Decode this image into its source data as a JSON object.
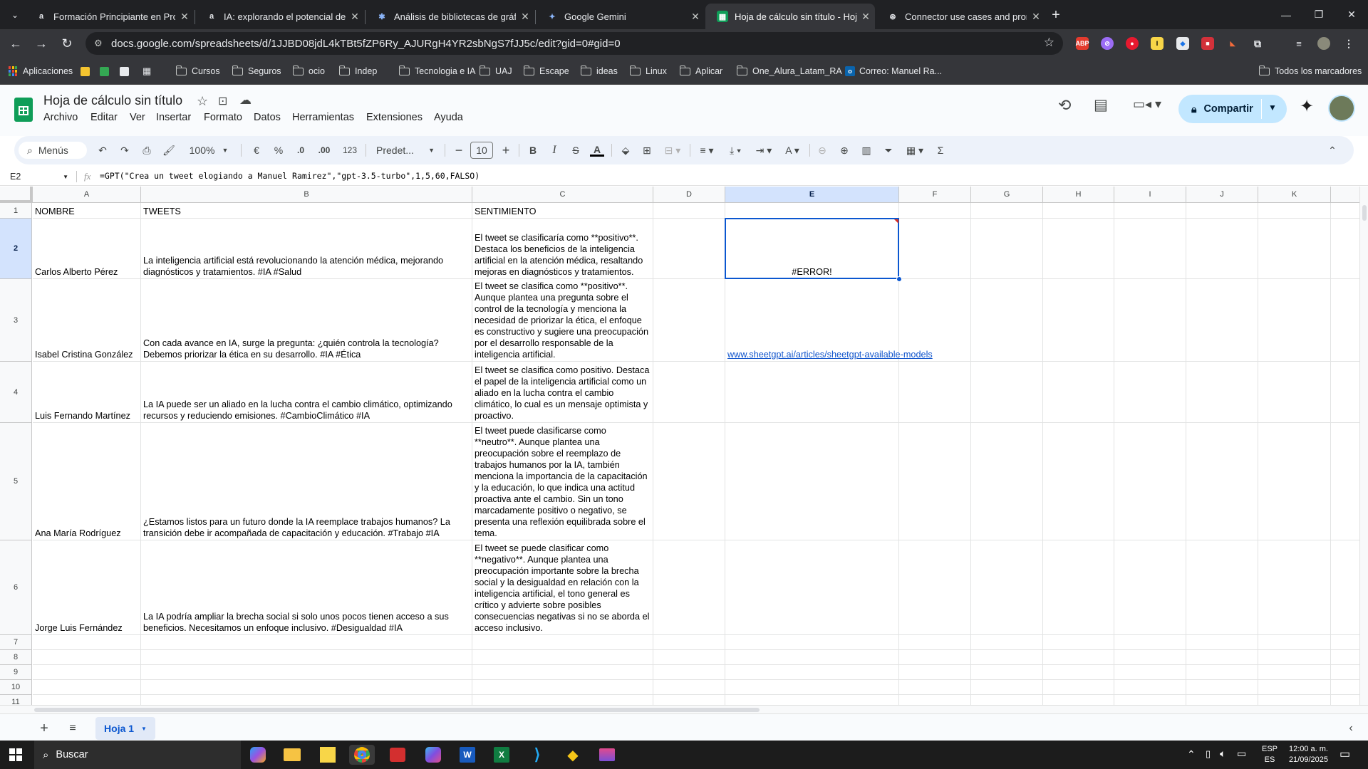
{
  "browser": {
    "tabs": [
      {
        "title": "Formación Principiante en Prog",
        "favicon": "alura-icon",
        "fav_letter": "a",
        "fav_bg": "#202124",
        "fav_fg": "#e8eaed",
        "active": false
      },
      {
        "title": "IA: explorando el potencial de l",
        "favicon": "alura-icon",
        "fav_letter": "a",
        "fav_bg": "#202124",
        "fav_fg": "#e8eaed",
        "active": false
      },
      {
        "title": "Análisis de bibliotecas de gráfic",
        "favicon": "claude-icon",
        "fav_letter": "✱",
        "fav_bg": "#202124",
        "fav_fg": "#8ab4f8",
        "active": false
      },
      {
        "title": "Google Gemini",
        "favicon": "gemini-icon",
        "fav_letter": "✦",
        "fav_bg": "#202124",
        "fav_fg": "#8ab4f8",
        "active": false
      },
      {
        "title": "Hoja de cálculo sin título - Hoja",
        "favicon": "sheets-icon",
        "fav_letter": "▦",
        "fav_bg": "#0f9d58",
        "fav_fg": "#ffffff",
        "active": true
      },
      {
        "title": "Connector use cases and promp",
        "favicon": "openai-icon",
        "fav_letter": "⊛",
        "fav_bg": "#202124",
        "fav_fg": "#e8eaed",
        "active": false
      }
    ],
    "url": "docs.google.com/spreadsheets/d/1JJBD08jdL4kTBt5fZP6Ry_AJURgH4YR2sbNgS7fJJ5c/edit?gid=0#gid=0",
    "bookmarks": {
      "apps": "Aplicaciones",
      "folders": [
        "Cursos",
        "Seguros",
        "ocio",
        "Indep",
        "Tecnologia e IA",
        "UAJ",
        "Escape",
        "ideas",
        "Linux",
        "Aplicar",
        "One_Alura_Latam_RA"
      ],
      "outlook": "Correo: Manuel Ra...",
      "all": "Todos los marcadores"
    }
  },
  "sheets": {
    "title": "Hoja de cálculo sin título",
    "menu": [
      "Archivo",
      "Editar",
      "Ver",
      "Insertar",
      "Formato",
      "Datos",
      "Herramientas",
      "Extensiones",
      "Ayuda"
    ],
    "share_label": "Compartir",
    "toolbar": {
      "search": "Menús",
      "zoom": "100%",
      "currency": "€",
      "percent": "%",
      "dec_less": ".0",
      "dec_more": ".00",
      "number_format": "123",
      "font": "Predet...",
      "font_size": "10"
    },
    "formula_bar": {
      "cell_ref": "E2",
      "fx": "fx",
      "formula": "=GPT(\"Crea un tweet elogiando a Manuel Ramirez\",\"gpt-3.5-turbo\",1,5,60,FALSO)"
    },
    "columns": [
      "A",
      "B",
      "C",
      "D",
      "E",
      "F",
      "G",
      "H",
      "I",
      "J",
      "K"
    ],
    "rows": [
      "1",
      "2",
      "3",
      "4",
      "5",
      "6",
      "7",
      "8",
      "9",
      "10",
      "11"
    ],
    "cells": {
      "A1": "NOMBRE",
      "B1": "TWEETS",
      "C1": "SENTIMIENTO",
      "A2": "Carlos Alberto Pérez",
      "B2": "La inteligencia artificial está revolucionando la atención médica, mejorando diagnósticos y tratamientos. #IA #Salud",
      "C2": "El tweet se clasificaría como **positivo**. Destaca los beneficios de la inteligencia artificial en la atención médica, resaltando mejoras en diagnósticos y tratamientos.",
      "E2": "#ERROR!",
      "A3": "Isabel Cristina González",
      "B3": "Con cada avance en IA, surge la pregunta: ¿quién controla la tecnología? Debemos priorizar la ética en su desarrollo. #IA #Ética",
      "C3": "El tweet se clasifica como **positivo**. Aunque plantea una pregunta sobre el control de la tecnología y menciona la necesidad de priorizar la ética, el enfoque es constructivo y sugiere una preocupación por el desarrollo responsable de la inteligencia artificial.",
      "E3": "www.sheetgpt.ai/articles/sheetgpt-available-models",
      "A4": "Luis Fernando Martínez",
      "B4": "La IA puede ser un aliado en la lucha contra el cambio climático, optimizando recursos y reduciendo emisiones. #CambioClimático #IA",
      "C4": "El tweet se clasifica como positivo. Destaca el papel de la inteligencia artificial como un aliado en la lucha contra el cambio climático, lo cual es un mensaje optimista y proactivo.",
      "A5": "Ana María Rodríguez",
      "B5": "¿Estamos listos para un futuro donde la IA reemplace trabajos humanos? La transición debe ir acompañada de capacitación y educación. #Trabajo #IA",
      "C5": "El tweet puede clasificarse como **neutro**. Aunque plantea una preocupación sobre el reemplazo de trabajos humanos por la IA, también menciona la importancia de la capacitación y la educación, lo que indica una actitud proactiva ante el cambio. Sin un tono marcadamente positivo o negativo, se presenta una reflexión equilibrada sobre el tema.",
      "A6": "Jorge Luis Fernández",
      "B6": "La IA podría ampliar la brecha social si solo unos pocos tienen acceso a sus beneficios. Necesitamos un enfoque inclusivo. #Desigualdad #IA",
      "C6": "El tweet se puede clasificar como **negativo**. Aunque plantea una preocupación importante sobre la brecha social y la desigualdad en relación con la inteligencia artificial, el tono general es crítico y advierte sobre posibles consecuencias negativas si no se aborda el acceso inclusivo."
    },
    "sheet_tab": "Hoja 1"
  },
  "taskbar": {
    "search": "Buscar",
    "lang": "ESP",
    "lang_sub": "ES",
    "time": "12:00 a. m.",
    "date": "21/09/2025"
  },
  "colors": {
    "accent": "#0b57d0",
    "selection": "#d3e3fd",
    "share_bg": "#c2e7ff",
    "link": "#1155cc"
  }
}
